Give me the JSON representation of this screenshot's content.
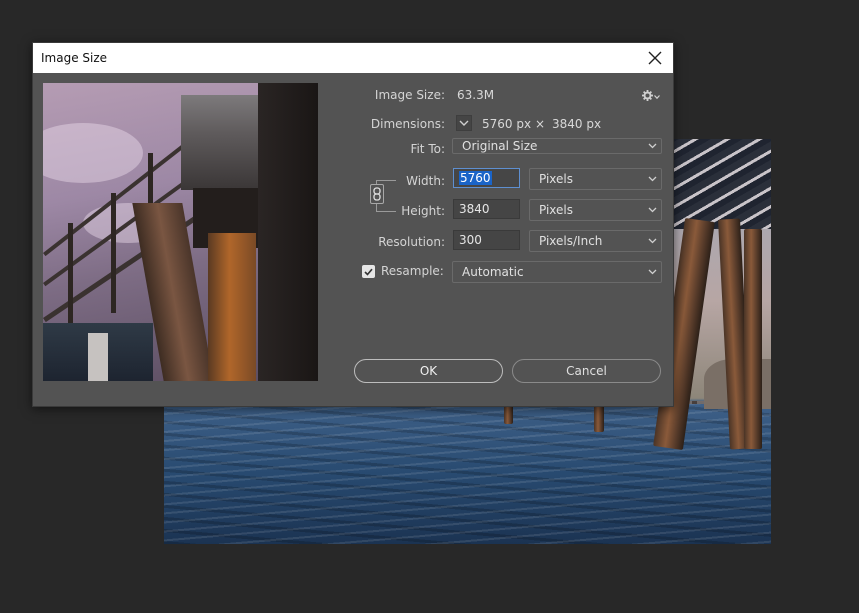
{
  "dialog": {
    "title": "Image Size"
  },
  "info": {
    "image_size_label": "Image Size:",
    "image_size_value": "63.3M",
    "dimensions_label": "Dimensions:",
    "dimensions_width": "5760 px",
    "dimensions_sep": "×",
    "dimensions_height": "3840 px"
  },
  "fit_to": {
    "label": "Fit To:",
    "value": "Original Size"
  },
  "width": {
    "label": "Width:",
    "value": "5760",
    "unit": "Pixels"
  },
  "height": {
    "label": "Height:",
    "value": "3840",
    "unit": "Pixels"
  },
  "resolution": {
    "label": "Resolution:",
    "value": "300",
    "unit": "Pixels/Inch"
  },
  "resample": {
    "label": "Resample:",
    "checked": true,
    "value": "Automatic"
  },
  "buttons": {
    "ok": "OK",
    "cancel": "Cancel"
  },
  "icons": {
    "close": "close-icon",
    "gear": "gear-icon",
    "link": "link-icon",
    "chevron": "chevron-down-icon",
    "check": "check-icon"
  },
  "colors": {
    "dialog_bg": "#535353",
    "app_bg": "#282828",
    "selection": "#1a64c8"
  }
}
